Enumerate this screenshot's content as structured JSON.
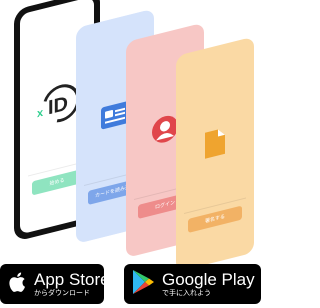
{
  "cards": [
    {
      "button_label": "始める",
      "icon": "xid-logo-icon"
    },
    {
      "button_label": "カードを読み込む",
      "icon": "id-card-icon"
    },
    {
      "button_label": "ログイン",
      "icon": "user-avatar-icon"
    },
    {
      "button_label": "署名する",
      "icon": "document-icon"
    }
  ],
  "logo": {
    "prefix": "x",
    "text": "ID"
  },
  "stores": {
    "apple": {
      "title": "App Store",
      "subtitle": "からダウンロード"
    },
    "google": {
      "title": "Google Play",
      "subtitle": "で手に入れよう"
    }
  },
  "colors": {
    "teal": "#8fe4c0",
    "blue": "#d5e3fb",
    "pink": "#f7c7c5",
    "orange": "#fad9a4"
  }
}
